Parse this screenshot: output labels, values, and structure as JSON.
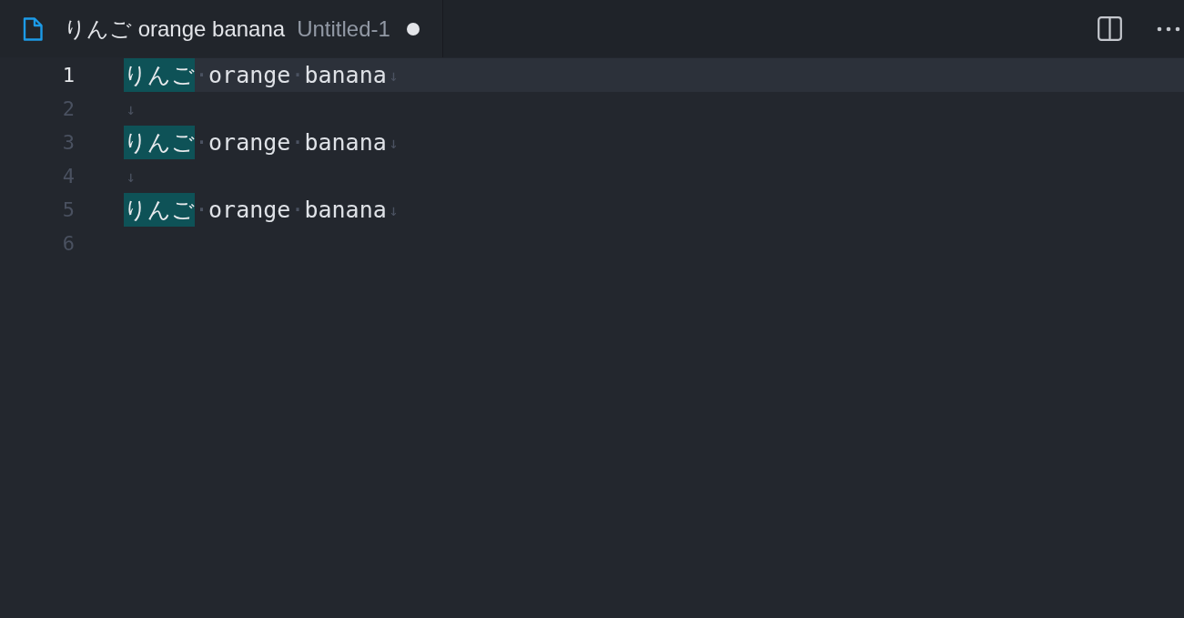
{
  "tabs": [
    {
      "title": "りんご orange banana",
      "description": "Untitled-1",
      "selected": true,
      "dirty": true
    }
  ],
  "editor": {
    "lines": [
      {
        "number": "1",
        "current": true,
        "segments": [
          {
            "text": "りんご",
            "kind": "match"
          },
          {
            "text": "·",
            "kind": "space"
          },
          {
            "text": "orange",
            "kind": "text"
          },
          {
            "text": "·",
            "kind": "space"
          },
          {
            "text": "banana",
            "kind": "text"
          },
          {
            "text": "↓",
            "kind": "eol"
          }
        ]
      },
      {
        "number": "2",
        "current": false,
        "segments": [
          {
            "text": "↓",
            "kind": "eol"
          }
        ]
      },
      {
        "number": "3",
        "current": false,
        "segments": [
          {
            "text": "りんご",
            "kind": "match"
          },
          {
            "text": "·",
            "kind": "space"
          },
          {
            "text": "orange",
            "kind": "text"
          },
          {
            "text": "·",
            "kind": "space"
          },
          {
            "text": "banana",
            "kind": "text"
          },
          {
            "text": "↓",
            "kind": "eol"
          }
        ]
      },
      {
        "number": "4",
        "current": false,
        "segments": [
          {
            "text": "↓",
            "kind": "eol"
          }
        ]
      },
      {
        "number": "5",
        "current": false,
        "segments": [
          {
            "text": "りんご",
            "kind": "match"
          },
          {
            "text": "·",
            "kind": "space"
          },
          {
            "text": "orange",
            "kind": "text"
          },
          {
            "text": "·",
            "kind": "space"
          },
          {
            "text": "banana",
            "kind": "text"
          },
          {
            "text": "↓",
            "kind": "eol"
          }
        ]
      },
      {
        "number": "6",
        "current": false
      }
    ]
  }
}
